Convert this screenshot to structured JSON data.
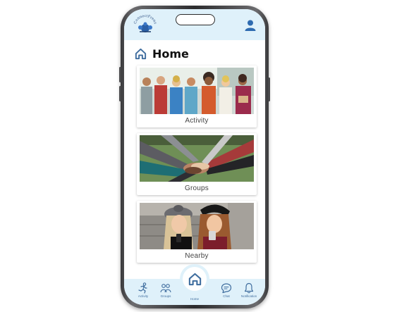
{
  "app": {
    "logo_text": "ConnectFrens"
  },
  "header": {
    "title": "Home"
  },
  "cards": [
    {
      "label": "Activity"
    },
    {
      "label": "Groups"
    },
    {
      "label": "Nearby"
    }
  ],
  "bottom_nav": {
    "items": [
      {
        "label": "Activity",
        "icon": "running-person-icon"
      },
      {
        "label": "Groups",
        "icon": "group-icon"
      },
      {
        "label": "Home",
        "icon": "home-icon"
      },
      {
        "label": "Chat",
        "icon": "chat-icon"
      },
      {
        "label": "Notification",
        "icon": "bell-icon"
      }
    ]
  },
  "colors": {
    "accent": "#3f6d9e",
    "bar_background": "#dff1fa"
  }
}
